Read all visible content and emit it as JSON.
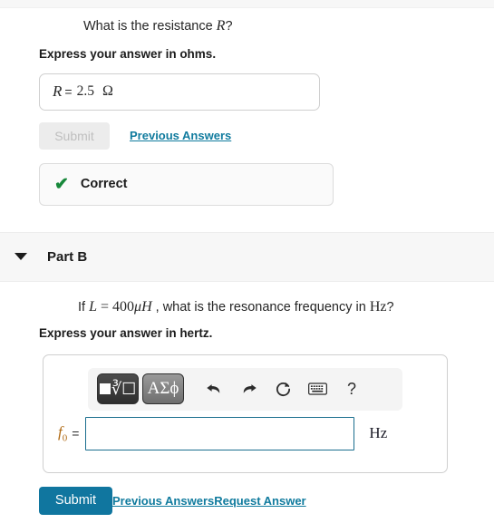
{
  "part_a": {
    "question": {
      "prefix": "What is the resistance ",
      "symbol": "R",
      "suffix": "?"
    },
    "instruction": "Express your answer in ohms.",
    "answer_field": {
      "label": "R",
      "equals": "=",
      "value": "2.5",
      "unit": "Ω"
    },
    "submit_label": "Submit",
    "previous_answers_label": "Previous Answers",
    "feedback": {
      "icon": "check-icon",
      "text": "Correct"
    }
  },
  "part_b": {
    "caret_icon": "chevron-down-icon",
    "title": "Part B",
    "question": {
      "prefix": "If ",
      "var": "L",
      "equals": " = ",
      "value": "400",
      "unit": "μH",
      "suffix": " , what is the resonance frequency in ",
      "unit2": "Hz",
      "end": "?"
    },
    "instruction": "Express your answer in hertz.",
    "toolbar": {
      "template_button": {
        "name": "math-template-button",
        "glyph": "√"
      },
      "symbols_button": {
        "name": "greek-symbols-button",
        "label": "ΑΣϕ"
      },
      "undo_button": "undo-icon",
      "redo_button": "redo-icon",
      "reset_button": "reset-icon",
      "keyboard_button": "keyboard-icon",
      "help_button": "?"
    },
    "answer_field": {
      "label": "f",
      "sub": "0",
      "equals": "=",
      "value": "",
      "placeholder": "",
      "unit": "Hz"
    },
    "submit_label": "Submit",
    "previous_answers_label": "Previous Answers",
    "request_answer_label": "Request Answer"
  },
  "colors": {
    "link": "#107b9e",
    "primary_button": "#10769f",
    "correct_green": "#17883a",
    "band_background": "#f7f7f7",
    "input_border": "#1a6e8e",
    "orange_var": "#b06a14"
  }
}
